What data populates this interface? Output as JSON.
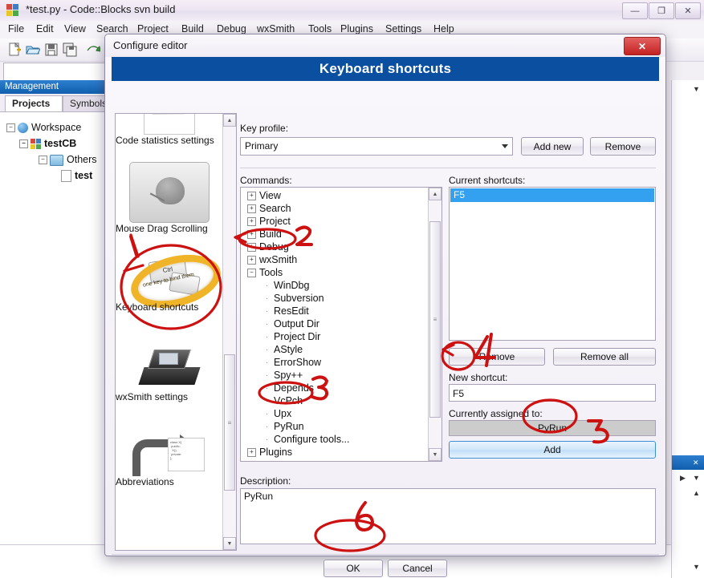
{
  "app": {
    "title": "*test.py - Code::Blocks svn build",
    "icon": "codeblocks-logo-icon",
    "window_buttons": [
      {
        "name": "minimize-button",
        "glyph": "—"
      },
      {
        "name": "maximize-button",
        "glyph": "❐"
      },
      {
        "name": "close-button",
        "glyph": "✕"
      }
    ],
    "menu": [
      "File",
      "Edit",
      "View",
      "Search",
      "Project",
      "Build",
      "Debug",
      "wxSmith",
      "Tools",
      "Plugins",
      "Settings",
      "Help"
    ],
    "toolbar_icons": [
      "new-file-icon",
      "open-file-icon",
      "save-icon",
      "save-all-icon",
      "undo-icon"
    ],
    "management": {
      "panel_title": "Management",
      "tabs": [
        "Projects",
        "Symbols"
      ],
      "active_tab": "Projects",
      "tree": [
        {
          "label": "Workspace",
          "icon": "workspace-icon",
          "depth": 0,
          "expander": "-"
        },
        {
          "label": "testCB",
          "icon": "project-icon",
          "depth": 1,
          "expander": "-"
        },
        {
          "label": "Others",
          "icon": "folder-icon",
          "depth": 2,
          "expander": "-"
        },
        {
          "label": "test",
          "icon": "file-icon",
          "depth": 3,
          "expander": ""
        }
      ]
    }
  },
  "dialog": {
    "title": "Configure editor",
    "close_label": "✕",
    "banner": "Keyboard shortcuts",
    "icon_list": [
      {
        "label": "Code statistics settings",
        "icon": "code-statistics-icon"
      },
      {
        "label": "Mouse Drag Scrolling",
        "icon": "mouse-drag-scrolling-icon"
      },
      {
        "label": "Keyboard shortcuts",
        "icon": "keyboard-shortcuts-icon",
        "selected": true
      },
      {
        "label": "wxSmith settings",
        "icon": "wxsmith-settings-icon"
      },
      {
        "label": "Abbreviations",
        "icon": "abbreviations-icon"
      }
    ],
    "keyboard_icon_text": {
      "key_label": "Ctrl",
      "ring_text": "one key to bind them"
    },
    "key_profile": {
      "label": "Key profile:",
      "value": "Primary",
      "add_new_label": "Add new",
      "remove_label": "Remove"
    },
    "commands": {
      "label": "Commands:",
      "tree": [
        {
          "label": "View",
          "depth": 0,
          "expander": "+"
        },
        {
          "label": "Search",
          "depth": 0,
          "expander": "+"
        },
        {
          "label": "Project",
          "depth": 0,
          "expander": "+"
        },
        {
          "label": "Build",
          "depth": 0,
          "expander": "+"
        },
        {
          "label": "Debug",
          "depth": 0,
          "expander": "+"
        },
        {
          "label": "wxSmith",
          "depth": 0,
          "expander": "+"
        },
        {
          "label": "Tools",
          "depth": 0,
          "expander": "-"
        },
        {
          "label": "WinDbg",
          "depth": 1,
          "expander": ""
        },
        {
          "label": "Subversion",
          "depth": 1,
          "expander": ""
        },
        {
          "label": "ResEdit",
          "depth": 1,
          "expander": ""
        },
        {
          "label": "Output Dir",
          "depth": 1,
          "expander": ""
        },
        {
          "label": "Project Dir",
          "depth": 1,
          "expander": ""
        },
        {
          "label": "AStyle",
          "depth": 1,
          "expander": ""
        },
        {
          "label": "ErrorShow",
          "depth": 1,
          "expander": ""
        },
        {
          "label": "Spy++",
          "depth": 1,
          "expander": ""
        },
        {
          "label": "Depends",
          "depth": 1,
          "expander": ""
        },
        {
          "label": "VcPch",
          "depth": 1,
          "expander": ""
        },
        {
          "label": "Upx",
          "depth": 1,
          "expander": ""
        },
        {
          "label": "PyRun",
          "depth": 1,
          "expander": ""
        },
        {
          "label": "Configure tools...",
          "depth": 1,
          "expander": ""
        },
        {
          "label": "Plugins",
          "depth": 0,
          "expander": "+"
        }
      ]
    },
    "current_shortcuts": {
      "label": "Current shortcuts:",
      "items": [
        "F5"
      ],
      "selected": "F5",
      "remove_label": "Remove",
      "remove_all_label": "Remove all"
    },
    "new_shortcut": {
      "label": "New shortcut:",
      "value": "F5",
      "placeholder": ""
    },
    "currently_assigned": {
      "label": "Currently assigned to:",
      "value": "PyRun"
    },
    "add_button": "Add",
    "description": {
      "label": "Description:",
      "value": "PyRun"
    },
    "ok_label": "OK",
    "cancel_label": "Cancel"
  },
  "annotations": {
    "numbers": [
      "1",
      "2",
      "3",
      "4",
      "5",
      "6"
    ],
    "color": "#cc1111",
    "targets": [
      {
        "number": "1",
        "target": "keyboard-shortcuts-icon-item"
      },
      {
        "number": "2",
        "target": "commands-tree-node-tools"
      },
      {
        "number": "3",
        "target": "commands-tree-node-pyrun"
      },
      {
        "number": "4",
        "target": "new-shortcut-input"
      },
      {
        "number": "5",
        "target": "add-shortcut-button"
      },
      {
        "number": "6",
        "target": "ok-button"
      }
    ]
  }
}
